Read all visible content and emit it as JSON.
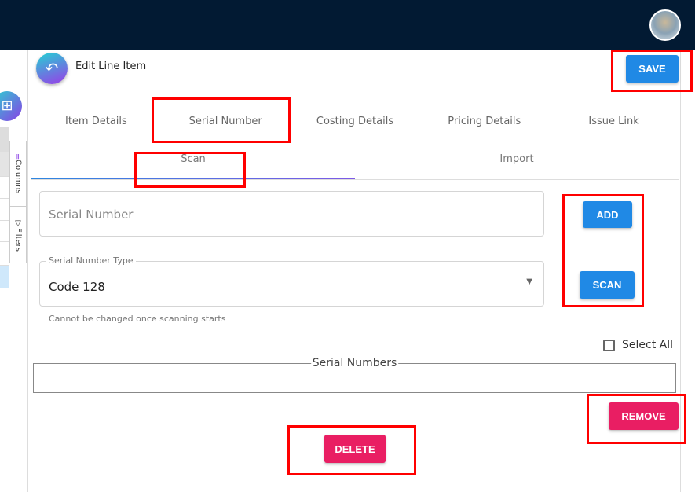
{
  "header": {
    "avatar": "user-avatar"
  },
  "sidebar": {
    "tabs": [
      {
        "label": "Columns",
        "icon": "columns-icon"
      },
      {
        "label": "Filters",
        "icon": "filter-icon"
      }
    ]
  },
  "dialog": {
    "title": "Edit Line Item",
    "save_label": "SAVE"
  },
  "tabs": [
    "Item Details",
    "Serial Number",
    "Costing Details",
    "Pricing Details",
    "Issue Link"
  ],
  "subtabs": [
    "Scan",
    "Import"
  ],
  "form": {
    "serial_placeholder": "Serial Number",
    "type_label": "Serial Number Type",
    "type_value": "Code 128",
    "type_helper": "Cannot be changed once scanning starts",
    "add_label": "ADD",
    "scan_label": "SCAN",
    "select_all": "Select All",
    "serial_numbers_legend": "Serial Numbers",
    "remove_label": "REMOVE",
    "delete_label": "DELETE"
  },
  "colors": {
    "topbar": "#021a33",
    "primary": "#2089e5",
    "danger": "#e91e63",
    "annotation": "#ff0000"
  }
}
